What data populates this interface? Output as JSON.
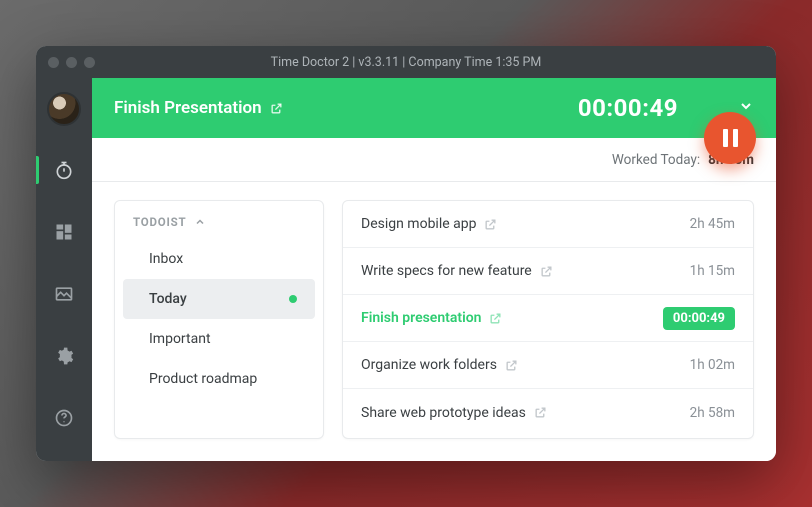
{
  "window": {
    "title": "Time Doctor 2 | v3.3.11 | Company Time 1:35 PM"
  },
  "header": {
    "task_title": "Finish Presentation",
    "timer": "00:00:49"
  },
  "worked_today": {
    "label": "Worked Today:",
    "value": "8h 15m"
  },
  "sidebar_section": {
    "title": "TODOIST",
    "folders": [
      {
        "label": "Inbox"
      },
      {
        "label": "Today"
      },
      {
        "label": "Important"
      },
      {
        "label": "Product roadmap"
      }
    ]
  },
  "tasks": [
    {
      "name": "Design mobile app",
      "time": "2h 45m"
    },
    {
      "name": "Write specs for new feature",
      "time": "1h 15m"
    },
    {
      "name": "Finish presentation",
      "time": "00:00:49"
    },
    {
      "name": "Organize work folders",
      "time": "1h 02m"
    },
    {
      "name": "Share web prototype ideas",
      "time": "2h 58m"
    }
  ]
}
